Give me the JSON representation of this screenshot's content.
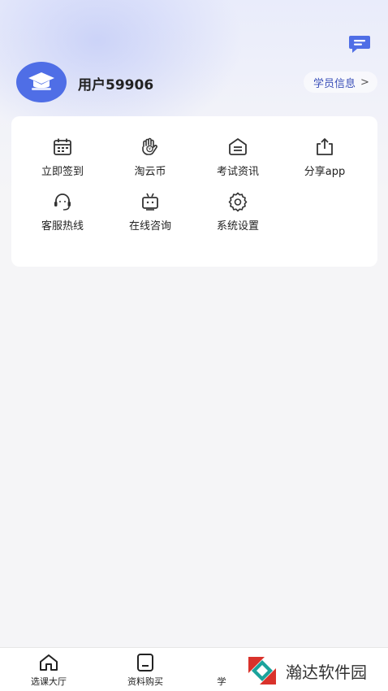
{
  "header": {
    "message_icon": "chat-message-icon",
    "avatar_icon": "graduation-cap-icon",
    "username": "用户59906",
    "student_info_label": "学员信息",
    "student_info_chevron": ">"
  },
  "grid": {
    "items": [
      {
        "label": "立即签到",
        "icon": "calendar-icon"
      },
      {
        "label": "淘云币",
        "icon": "coin-hand-icon"
      },
      {
        "label": "考试资讯",
        "icon": "news-icon"
      },
      {
        "label": "分享app",
        "icon": "share-icon"
      },
      {
        "label": "客服热线",
        "icon": "headset-icon"
      },
      {
        "label": "在线咨询",
        "icon": "tv-bot-icon"
      },
      {
        "label": "系统设置",
        "icon": "gear-icon"
      }
    ]
  },
  "bottom_nav": {
    "tabs": [
      {
        "label": "选课大厅",
        "icon": "home-icon"
      },
      {
        "label": "资料购买",
        "icon": "document-icon"
      },
      {
        "label": "学",
        "icon": "partially-hidden"
      }
    ]
  },
  "watermark": {
    "text": "瀚达软件园"
  },
  "colors": {
    "accent": "#4f6ee6",
    "link": "#3a4fb8",
    "background": "#f5f5f7"
  }
}
